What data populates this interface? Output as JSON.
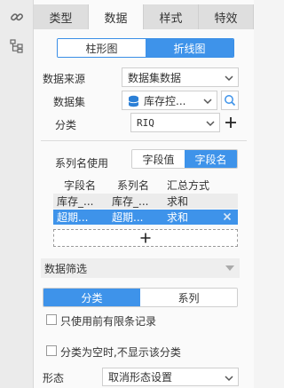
{
  "left_toolbar": [
    {
      "icon": "link-icon"
    },
    {
      "icon": "tree-structure-icon"
    }
  ],
  "tabs": [
    {
      "label": "类型",
      "active": false
    },
    {
      "label": "数据",
      "active": true
    },
    {
      "label": "样式",
      "active": false
    },
    {
      "label": "特效",
      "active": false
    }
  ],
  "chart_kind_toggle": {
    "options": [
      {
        "label": "柱形图",
        "selected": false
      },
      {
        "label": "折线图",
        "selected": true
      }
    ]
  },
  "data_source": {
    "label": "数据来源",
    "value": "数据集数据"
  },
  "dataset": {
    "label": "数据集",
    "value": "库存控..."
  },
  "category": {
    "label": "分类",
    "value": "RIQ"
  },
  "series_name": {
    "label": "系列名使用",
    "options": [
      {
        "label": "字段值",
        "selected": false
      },
      {
        "label": "字段名",
        "selected": true
      }
    ]
  },
  "field_table": {
    "headers": [
      "字段名",
      "系列名",
      "汇总方式"
    ],
    "rows": [
      {
        "field": "库存_...",
        "series": "库存_...",
        "agg": "求和",
        "selected": false
      },
      {
        "field": "超期...",
        "series": "超期...",
        "agg": "求和",
        "selected": true
      }
    ]
  },
  "data_filter": {
    "title": "数据筛选",
    "tabs": [
      {
        "label": "分类",
        "selected": true
      },
      {
        "label": "系列",
        "selected": false
      }
    ],
    "checkboxes": [
      {
        "label": "只使用前有限条记录",
        "checked": false
      },
      {
        "label": "分类为空时,不显示该分类",
        "checked": false
      }
    ]
  },
  "form": {
    "label": "形态",
    "value": "取消形态设置"
  },
  "colors": {
    "accent": "#3e93ea",
    "dataset_icon": "#2b7fd6"
  }
}
